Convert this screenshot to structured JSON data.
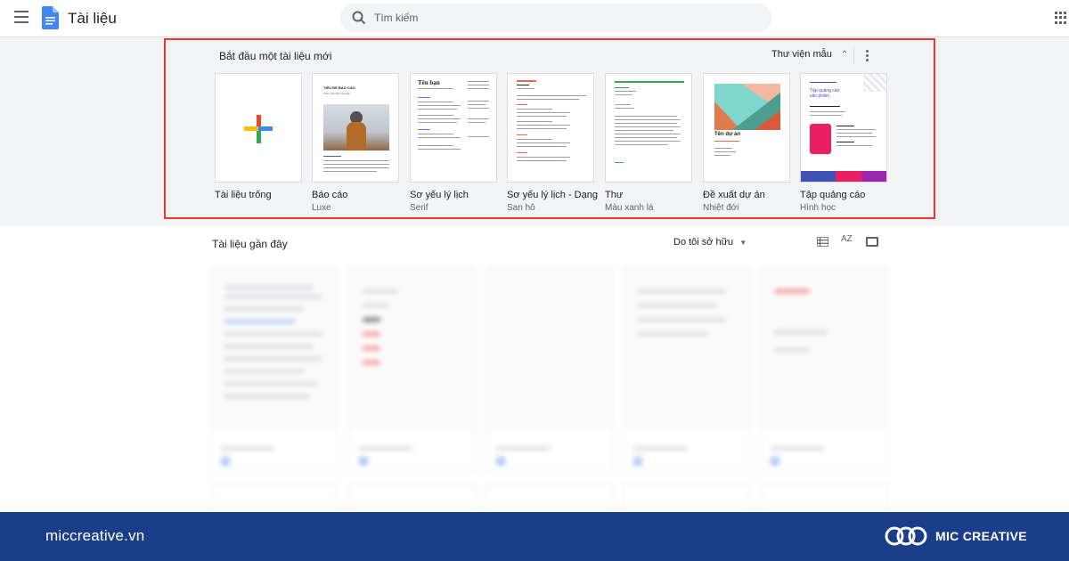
{
  "header": {
    "app_title": "Tài liệu",
    "search_placeholder": "Tìm kiếm",
    "menu_icon": "hamburger-menu-icon",
    "apps_icon": "google-apps-grid-icon"
  },
  "template_gallery": {
    "title": "Bắt đầu một tài liệu mới",
    "library_label": "Thư viện mẫu",
    "highlight_color": "#e53935",
    "templates": [
      {
        "name": "Tài liệu trống",
        "subtitle": ""
      },
      {
        "name": "Báo cáo",
        "subtitle": "Luxe",
        "thumb_heading": "TIÊU ĐỀ BÁO CÁO",
        "thumb_sub": "Chèn văn bản của bạn"
      },
      {
        "name": "Sơ yếu lý lịch",
        "subtitle": "Serif",
        "thumb_heading": "Tên bạn"
      },
      {
        "name": "Sơ yếu lý lịch - Dạng",
        "subtitle": "San hô"
      },
      {
        "name": "Thư",
        "subtitle": "Màu xanh lá"
      },
      {
        "name": "Đề xuất dự án",
        "subtitle": "Nhiệt đới",
        "thumb_heading": "Tên dự án"
      },
      {
        "name": "Tập quảng cáo",
        "subtitle": "Hình học",
        "thumb_heading": "Tập quảng cáo sản phẩm"
      }
    ]
  },
  "recent": {
    "title": "Tài liệu gần đây",
    "owner_filter": "Do tôi sở hữu",
    "sort_label": "AZ"
  },
  "footer": {
    "url": "miccreative.vn",
    "brand": "MIC CREATIVE",
    "background_color": "#1a3e8a"
  }
}
